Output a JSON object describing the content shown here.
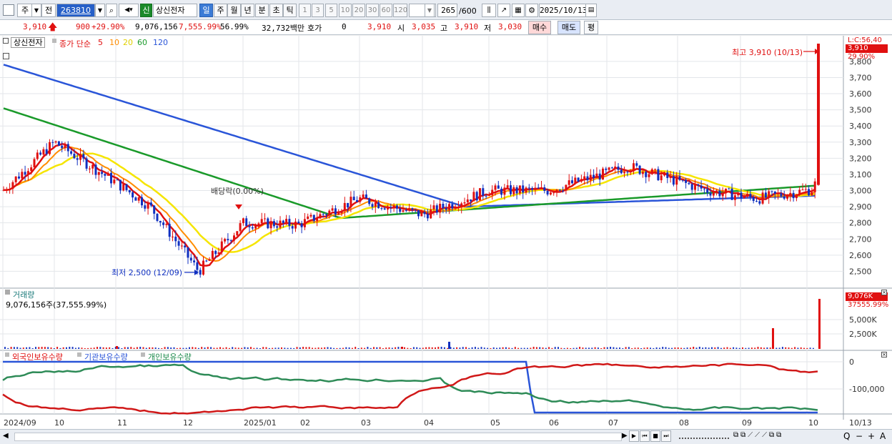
{
  "toolbar": {
    "market_label": "주",
    "prev_label": "전",
    "code": "263810",
    "badge": "신",
    "name": "상신전자",
    "periods": [
      "일",
      "주",
      "월",
      "년",
      "분",
      "초",
      "틱"
    ],
    "intervals": [
      "1",
      "3",
      "5",
      "10",
      "20",
      "30",
      "60",
      "120"
    ],
    "count_display": "265",
    "count_total": "/600",
    "date": "2025/10/13"
  },
  "quote": {
    "price": "3,910",
    "change": "900",
    "change_pct": "+29.90%",
    "volume": "9,076,156",
    "volume_pct": "7,555.99%",
    "turnover_pct": "56.99%",
    "amount": "32,732백만",
    "hoga_label": "호가",
    "hoga_value": "0",
    "bid": "3,910",
    "open_label": "시",
    "open": "3,035",
    "high_label": "고",
    "high": "3,910",
    "low_label": "저",
    "low": "3,030",
    "buy_label": "매수",
    "sell_label": "매도",
    "eval_label": "평"
  },
  "price_panel": {
    "stock_label": "상신전자",
    "legend_prefix": "종가 단순",
    "ma_periods": [
      "5",
      "10",
      "20",
      "60",
      "120"
    ],
    "corner_label": "L:C:56,40",
    "current_tag": "3,910",
    "current_pct": "29.90%",
    "high_annotation": "최고 3,910 (10/13)",
    "low_annotation": "최저 2,500 (12/09)",
    "dividend_annotation": "배당락(0.00%)",
    "y_ticks": [
      "3,800",
      "3,700",
      "3,600",
      "3,500",
      "3,400",
      "3,300",
      "3,200",
      "3,100",
      "3,000",
      "2,900",
      "2,800",
      "2,700",
      "2,600",
      "2,500"
    ]
  },
  "volume_panel": {
    "title": "거래량",
    "value_line": "9,076,156주(37,555.99%)",
    "tag": "9,076K",
    "tag_pct": "37555.99%",
    "y_ticks": [
      "5,000K",
      "2,500K"
    ]
  },
  "holdings_panel": {
    "legend": [
      "외국인보유수량",
      "기관보유수량",
      "개인보유수량"
    ],
    "y_ticks": [
      "0",
      "-100,000"
    ]
  },
  "x_axis": [
    "2024/09",
    "10",
    "11",
    "12",
    "2025/01",
    "02",
    "03",
    "04",
    "05",
    "06",
    "07",
    "08",
    "09",
    "10",
    "10/13"
  ],
  "chart_data": {
    "type": "candlestick",
    "y_range": [
      2400,
      3950
    ],
    "close_series": [
      {
        "date": "2024/09",
        "close": 3000
      },
      {
        "date": "2024/10",
        "close": 3300
      },
      {
        "date": "2024/11",
        "close": 3050
      },
      {
        "date": "2024/11 late",
        "close": 2900
      },
      {
        "date": "2024/12/09",
        "close": 2500
      },
      {
        "date": "2025/01",
        "close": 2800
      },
      {
        "date": "2025/02",
        "close": 2790
      },
      {
        "date": "2025/03",
        "close": 2950
      },
      {
        "date": "2025/04",
        "close": 2850
      },
      {
        "date": "2025/05",
        "close": 3000
      },
      {
        "date": "2025/06",
        "close": 3000
      },
      {
        "date": "2025/07",
        "close": 3150
      },
      {
        "date": "2025/08",
        "close": 3000
      },
      {
        "date": "2025/09",
        "close": 2950
      },
      {
        "date": "2025/10/10",
        "close": 3010
      },
      {
        "date": "2025/10/13",
        "close": 3910
      }
    ],
    "ma_colors": {
      "5": "#e01010",
      "10": "#ff8c00",
      "20": "#f5e500",
      "60": "#1a9a2a",
      "120": "#2a55d8"
    },
    "annotations": {
      "high": 3910,
      "low": 2500,
      "last_volume": 9076156
    }
  },
  "bottom_bar": {
    "controls": [
      "▶",
      "⏮",
      "■",
      "⏭"
    ],
    "right_icons": [
      "Q",
      "−",
      "+",
      "A"
    ]
  }
}
